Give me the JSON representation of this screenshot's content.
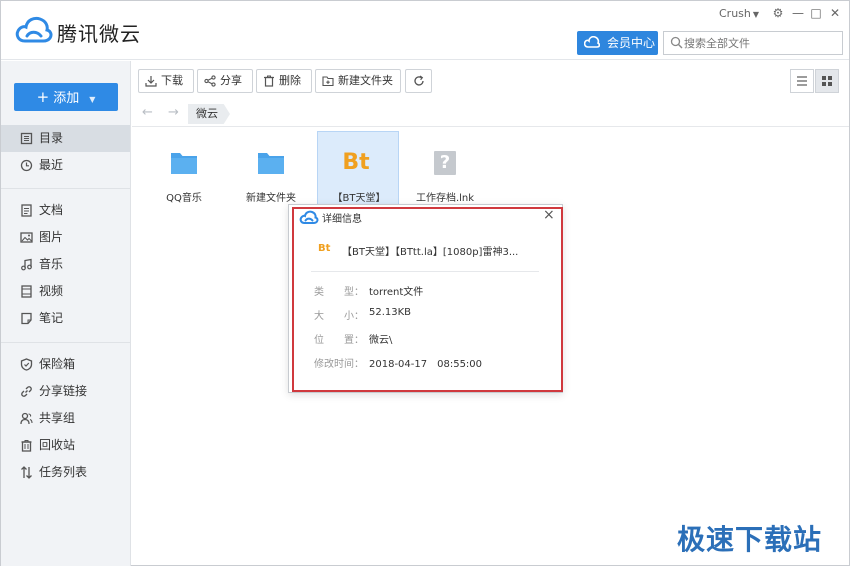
{
  "app": {
    "title": "腾讯微云",
    "user": "Crush",
    "vip_label": "会员中心",
    "search_placeholder": "搜索全部文件"
  },
  "sidebar": {
    "add_label": "添加",
    "items": [
      {
        "label": "目录",
        "icon": "folder-list-icon",
        "active": true
      },
      {
        "label": "最近",
        "icon": "clock-icon"
      },
      {
        "label": "文档",
        "icon": "document-icon"
      },
      {
        "label": "图片",
        "icon": "image-icon"
      },
      {
        "label": "音乐",
        "icon": "music-icon"
      },
      {
        "label": "视频",
        "icon": "video-icon"
      },
      {
        "label": "笔记",
        "icon": "note-icon"
      },
      {
        "label": "保险箱",
        "icon": "shield-icon"
      },
      {
        "label": "分享链接",
        "icon": "link-icon"
      },
      {
        "label": "共享组",
        "icon": "group-icon"
      },
      {
        "label": "回收站",
        "icon": "trash-icon"
      },
      {
        "label": "任务列表",
        "icon": "transfer-icon"
      }
    ]
  },
  "toolbar": {
    "download": "下载",
    "share": "分享",
    "delete": "删除",
    "new_folder": "新建文件夹"
  },
  "breadcrumb": {
    "current": "微云"
  },
  "files": [
    {
      "name": "QQ音乐",
      "type": "folder"
    },
    {
      "name": "新建文件夹",
      "type": "folder"
    },
    {
      "name": "【BT天堂】",
      "type": "bt",
      "selected": true,
      "icon_text": "Bt"
    },
    {
      "name": "工作存档.lnk",
      "type": "unknown",
      "icon_text": "?"
    }
  ],
  "dialog": {
    "title": "详细信息",
    "icon_text": "Bt",
    "filename": "【BT天堂】【BTtt.la】[1080p]雷神3...",
    "rows": [
      {
        "label": "类　　型：",
        "value": "torrent文件"
      },
      {
        "label": "大　　小：",
        "value": "52.13KB"
      },
      {
        "label": "位　　置：",
        "value": "微云\\"
      },
      {
        "label": "修改时间：",
        "value": "2018-04-17　08:55:00"
      }
    ]
  },
  "watermark": "极速下载站",
  "colors": {
    "accent": "#2f8ae5",
    "folder": "#4aa3ea",
    "bt": "#f0a020",
    "highlight": "#d0393e"
  }
}
